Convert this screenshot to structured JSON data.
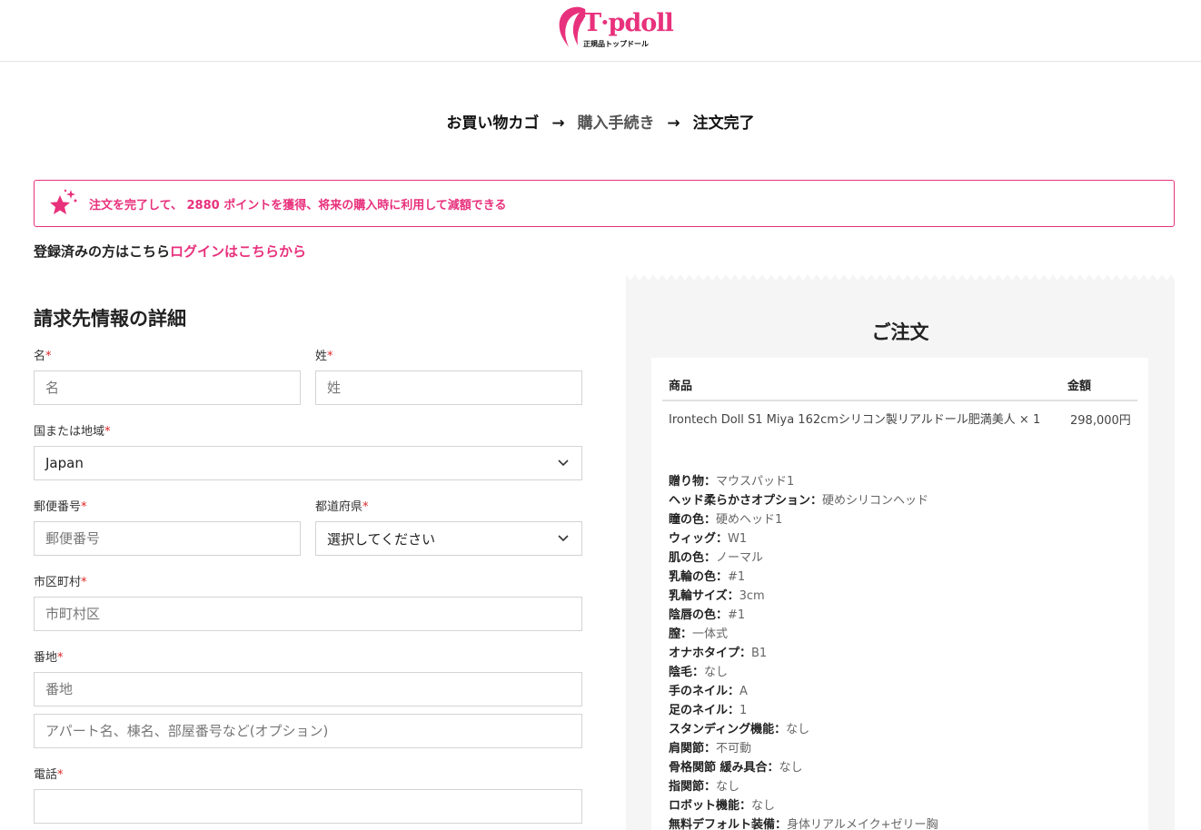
{
  "logo": {
    "text": "T·pdoll",
    "subtitle": "正規品トップドール",
    "brand_color": "#e8317c"
  },
  "steps": {
    "cart": "お買い物カゴ",
    "arrow": "→",
    "checkout": "購入手続き",
    "complete": "注文完了"
  },
  "notice": {
    "text": "注文を完了して、 2880 ポイントを獲得、将来の購入時に利用して減額できる"
  },
  "login": {
    "prompt": "登録済みの方はこちら",
    "link": "ログインはこちらから"
  },
  "billing": {
    "title": "請求先情報の詳細",
    "required_mark": "*",
    "first_name": {
      "label": "名",
      "placeholder": "名"
    },
    "last_name": {
      "label": "姓",
      "placeholder": "姓"
    },
    "country": {
      "label": "国または地域",
      "value": "Japan"
    },
    "postcode": {
      "label": "郵便番号",
      "placeholder": "郵便番号"
    },
    "prefecture": {
      "label": "都道府県",
      "value": "選択してください"
    },
    "city": {
      "label": "市区町村",
      "placeholder": "市町村区"
    },
    "address": {
      "label": "番地",
      "placeholder": "番地",
      "placeholder2": "アパート名、棟名、部屋番号など(オプション)"
    },
    "phone": {
      "label": "電話",
      "placeholder": ""
    }
  },
  "order": {
    "title": "ご注文",
    "col_product": "商品",
    "col_total": "金額",
    "product_name": "Irontech Doll S1 Miya 162cmシリコン製リアルドール肥満美人 × 1",
    "product_price": "298,000円",
    "attributes": [
      {
        "key": "贈り物：",
        "value": "マウスパッド1"
      },
      {
        "key": "ヘッド柔らかさオプション：",
        "value": "硬めシリコンヘッド"
      },
      {
        "key": "瞳の色：",
        "value": "硬めヘッド1"
      },
      {
        "key": "ウィッグ：",
        "value": "W1"
      },
      {
        "key": "肌の色：",
        "value": "ノーマル"
      },
      {
        "key": "乳輪の色：",
        "value": "#1"
      },
      {
        "key": "乳輪サイズ：",
        "value": "3cm"
      },
      {
        "key": "陰唇の色：",
        "value": "#1"
      },
      {
        "key": "膣：",
        "value": "一体式"
      },
      {
        "key": "オナホタイプ：",
        "value": "B1"
      },
      {
        "key": "陰毛：",
        "value": "なし"
      },
      {
        "key": "手のネイル：",
        "value": "A"
      },
      {
        "key": "足のネイル：",
        "value": "1"
      },
      {
        "key": "スタンディング機能：",
        "value": "なし"
      },
      {
        "key": "肩関節：",
        "value": "不可動"
      },
      {
        "key": "骨格関節 緩み具合：",
        "value": "なし"
      },
      {
        "key": "指関節：",
        "value": "なし"
      },
      {
        "key": "ロボット機能：",
        "value": "なし"
      },
      {
        "key": "無料デフォルト装備：",
        "value": "身体リアルメイク+ゼリー胸"
      }
    ]
  },
  "icons": {
    "logo": "hair-silhouette-icon",
    "notice": "sparkle-star-icon",
    "select": "chevron-down-icon"
  }
}
